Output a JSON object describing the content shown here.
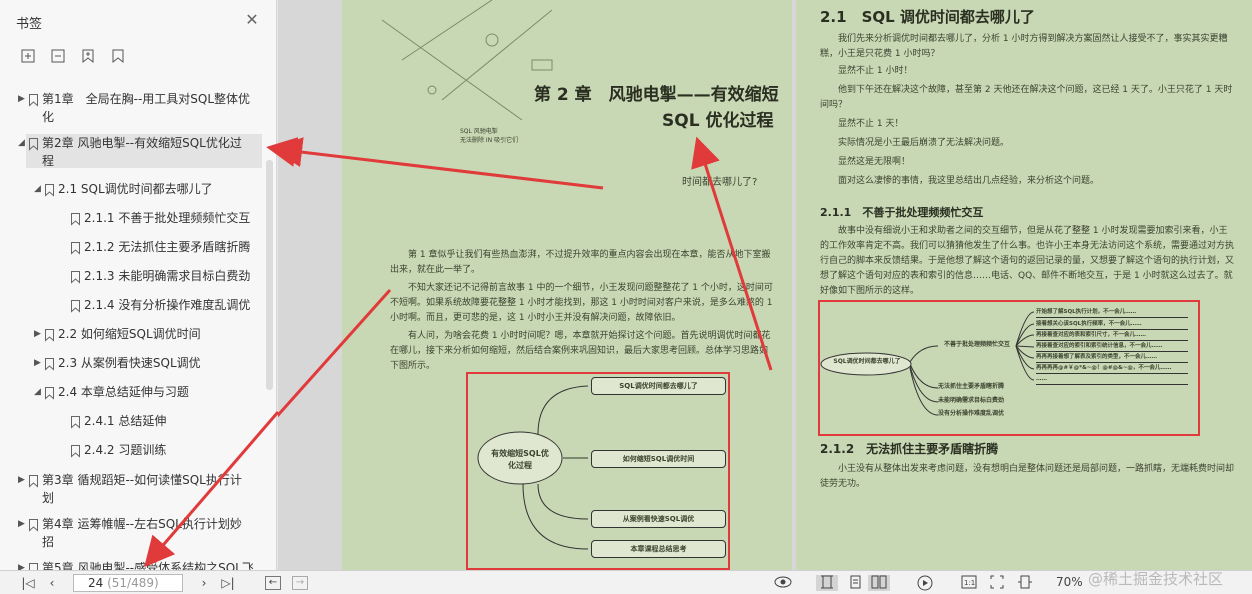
{
  "sidebar": {
    "title": "书签",
    "close_icon": "close-icon",
    "tools": [
      "expand-bookmark-icon",
      "collapse-bookmark-icon",
      "add-bookmark-icon",
      "bookmark-icon"
    ],
    "tree": [
      {
        "label1": "第1章　全局在胸--用工具对SQL整体优",
        "label2": "化",
        "level": 0,
        "expanded": false
      },
      {
        "label1": "第2章 风驰电掣--有效缩短SQL优化过",
        "label2": "程",
        "level": 0,
        "expanded": true,
        "selected": true
      },
      {
        "label1": "2.1 SQL调优时间都去哪儿了",
        "level": 1,
        "expanded": true
      },
      {
        "label1": "2.1.1 不善于批处理频频忙交互",
        "level": 2
      },
      {
        "label1": "2.1.2 无法抓住主要矛盾瞎折腾",
        "level": 2
      },
      {
        "label1": "2.1.3 未能明确需求目标白费劲",
        "level": 2
      },
      {
        "label1": "2.1.4 没有分析操作难度乱调优",
        "level": 2
      },
      {
        "label1": "2.2 如何缩短SQL调优时间",
        "level": 1,
        "expanded": false
      },
      {
        "label1": "2.3 从案例看快速SQL调优",
        "level": 1,
        "expanded": false
      },
      {
        "label1": "2.4 本章总结延伸与习题",
        "level": 1,
        "expanded": true
      },
      {
        "label1": "2.4.1 总结延伸",
        "level": 2
      },
      {
        "label1": "2.4.2 习题训练",
        "level": 2
      },
      {
        "label1": "第3章 循规蹈矩--如何读懂SQL执行计",
        "label2": "划",
        "level": 0,
        "expanded": false
      },
      {
        "label1": "第4章 运筹帷幄--左右SQL执行计划妙",
        "label2": "招",
        "level": 0,
        "expanded": false
      },
      {
        "label1": "第5章 风驰电掣--感受体系结构之SQL飞",
        "level": 0,
        "expanded": false
      }
    ]
  },
  "left_page": {
    "chapter_title1": "第 2 章　风驰电掣——有效缩短",
    "chapter_title2": "SQL 优化过程",
    "fig_caption1": "SQL 风驰电掣",
    "fig_caption2": "无法删除 IN 吸引它们",
    "question": "时间都去哪儿了?",
    "para1": "第 1 章似乎让我们有些热血澎湃，不过提升效率的重点内容会出现在本章，能否从地下室搬出来，就在此一举了。",
    "para2": "不知大家还记不记得前言故事 1 中的一个细节，小王发现问题整整花了 1 个小时，这时间可不短啊。如果系统故障要花整整 1 小时才能找到，那这 1 小时时间对客户来说，是多么难熬的 1 小时啊。而且，更可悲的是，这 1 小时小王并没有解决问题，故障依旧。",
    "para3": "有人问，为啥会花费 1 小时时间呢？嗯，本章就开始探讨这个问题。首先说明调优时间都花在哪儿，接下来分析如何缩短，然后结合案例来巩固知识，最后大家思考回顾。总体学习思路如下图所示。",
    "mindmap": {
      "center": "有效缩短SQL优化过程",
      "branches": [
        "SQL调优时间都去哪儿了",
        "如何缩短SQL调优时间",
        "从案例看快速SQL调优",
        "本章课程总结思考"
      ]
    }
  },
  "right_page": {
    "h1": "2.1　SQL 调优时间都去哪儿了",
    "p1": "我们先来分析调优时间都去哪儿了，分析 1 小时方得到解决方案固然让人接受不了，事实其实更糟糕，小王是只花费 1 小时吗？",
    "p2": "显然不止 1 小时！",
    "p3": "他到下午还在解决这个故障，甚至第 2 天他还在解决这个问题，这已经 1 天了。小王只花了 1 天时间吗？",
    "p4": "显然不止 1 天！",
    "p5": "实际情况是小王最后崩溃了无法解决问题。",
    "p6": "显然这是无限啊！",
    "p7": "面对这么凄惨的事情，我这里总结出几点经验，来分析这个问题。",
    "h2": "2.1.1　不善于批处理频频忙交互",
    "p8": "故事中没有细说小王和求助者之间的交互细节，但是从花了整整 1 小时发现需要加索引来看，小王的工作效率肯定不高。我们可以猜猜他发生了什么事。也许小王本身无法访问这个系统，需要通过对方执行自己的脚本来反馈结果。于是他想了解这个语句的返回记录的量，又想要了解这个语句的执行计划，又想了解这个语句对应的表和索引的信息……电话、QQ、邮件不断地交互，于是 1 小时就这么过去了。就好像如下图所示的这样。",
    "mindmap": {
      "center": "SQL调优时间都去哪儿了",
      "branch1": "不善于批处理频频忙交互",
      "leaves": [
        "开始想了解SQL执行计划，不一会儿……",
        "接着想关心该SQL执行频率，不一会儿……",
        "再接着查对应的表和索引尺寸，不一会儿……",
        "再接着查对应的索引和索引统计信息，不一会儿……",
        "再再再接着想了解表及索引的类型，不一会儿……",
        "再再再再@#￥@*&~@！@#@&~@，不一会儿……",
        "……"
      ],
      "others": [
        "无法抓住主要矛盾瞎折腾",
        "未能明确需求目标白费劲",
        "没有分析操作难度乱调优"
      ]
    },
    "h3": "2.1.2　无法抓住主要矛盾瞎折腾",
    "p9": "小王没有从整体出发来考虑问题，没有想明白是整体问题还是局部问题，一路抓瞎，无端耗费时间却徒劳无功。"
  },
  "bottombar": {
    "page_current": "24",
    "page_total": "(51/489)",
    "zoom": "70%",
    "watermark": "@稀土掘金技术社区"
  },
  "colors": {
    "accent_red": "#e03a3a",
    "page_bg": "#c9d8b4"
  }
}
